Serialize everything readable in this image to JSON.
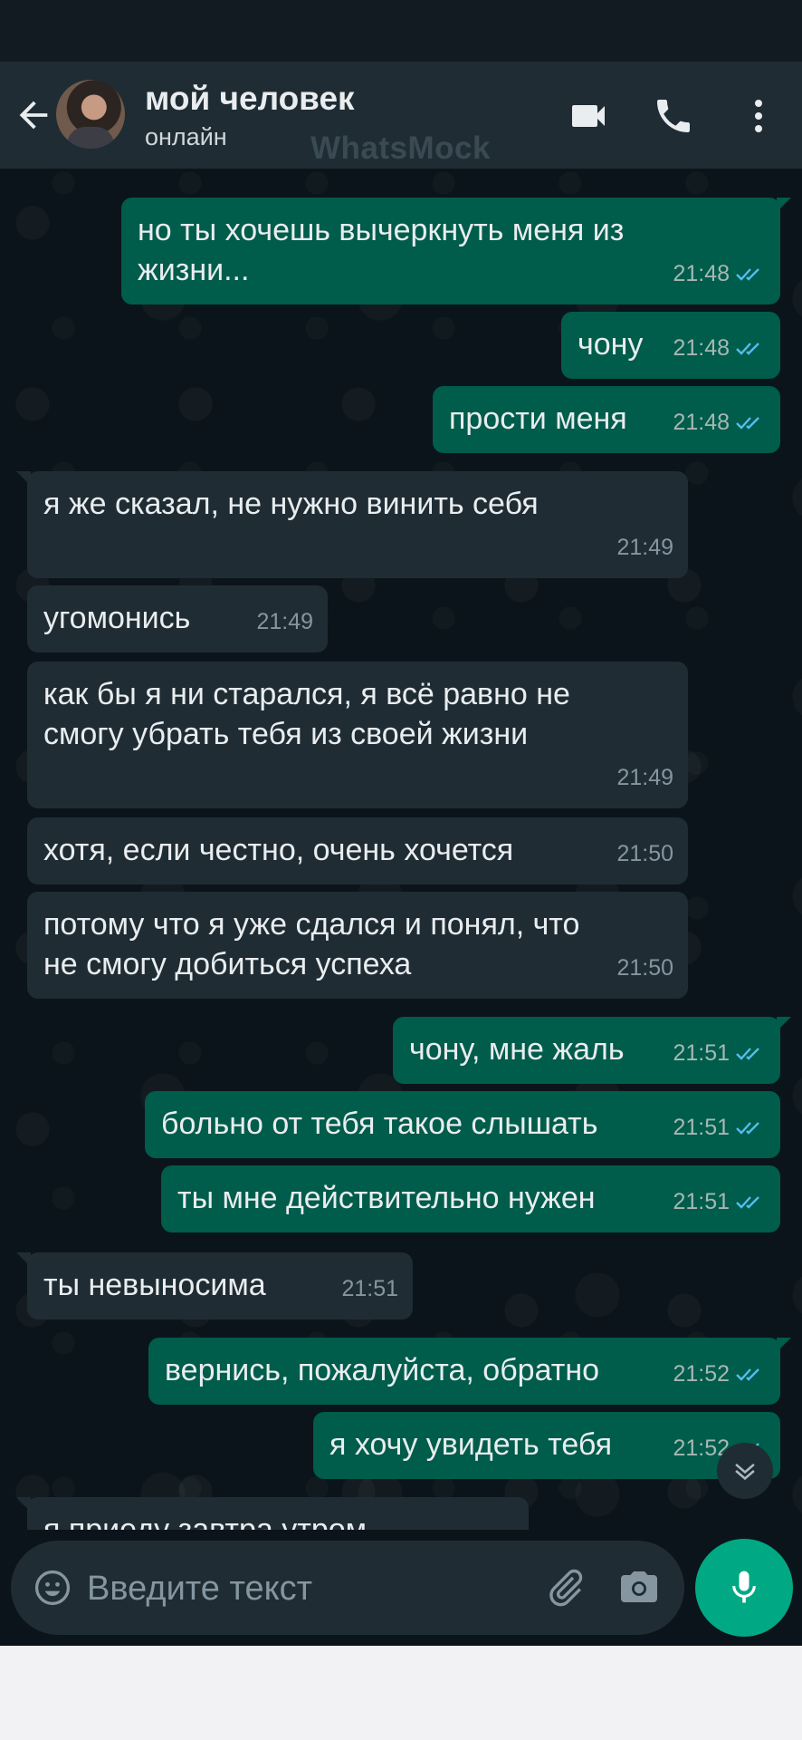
{
  "header": {
    "contact_name": "мой человек",
    "status": "онлайн",
    "watermark": "WhatsMock",
    "icons": [
      "back-arrow-icon",
      "video-call-icon",
      "phone-icon",
      "more-vert-icon"
    ]
  },
  "messages": [
    {
      "dir": "out",
      "text": "но ты хочешь вычеркнуть меня из\nжизни...",
      "time": "21:48",
      "read": true
    },
    {
      "dir": "out",
      "text": "чону",
      "time": "21:48",
      "read": true
    },
    {
      "dir": "out",
      "text": "прости меня",
      "time": "21:48",
      "read": true
    },
    {
      "dir": "in",
      "text": "я же сказал, не нужно винить себя",
      "time": "21:49"
    },
    {
      "dir": "in",
      "text": "угомонись",
      "time": "21:49"
    },
    {
      "dir": "in",
      "text": "как бы я ни старался, я всё равно не\nсмогу убрать тебя из своей жизни",
      "time": "21:49"
    },
    {
      "dir": "in",
      "text": "хотя, если честно, очень хочется",
      "time": "21:50"
    },
    {
      "dir": "in",
      "text": "потому что я уже сдался и понял, что\nне смогу добиться успеха",
      "time": "21:50"
    },
    {
      "dir": "out",
      "text": "чону, мне жаль",
      "time": "21:51",
      "read": true
    },
    {
      "dir": "out",
      "text": "больно от тебя такое слышать",
      "time": "21:51",
      "read": true
    },
    {
      "dir": "out",
      "text": "ты мне действительно нужен",
      "time": "21:51",
      "read": true
    },
    {
      "dir": "in",
      "text": "ты невыносима",
      "time": "21:51"
    },
    {
      "dir": "out",
      "text": "вернись, пожалуйста, обратно",
      "time": "21:52",
      "read": true
    },
    {
      "dir": "out",
      "text": "я хочу увидеть тебя",
      "time": "21:52",
      "read": true
    },
    {
      "dir": "in",
      "text": "я приеду завтра утром",
      "time": ""
    }
  ],
  "composer": {
    "placeholder": "Введите текст",
    "icons": [
      "emoji-icon",
      "attach-icon",
      "camera-icon",
      "mic-icon"
    ]
  },
  "colors": {
    "background": "#0b141a",
    "header": "#1f2c34",
    "outgoing_bubble": "#005c4b",
    "incoming_bubble": "#1f2c34",
    "read_ticks": "#53bdeb",
    "accent": "#00a884"
  }
}
